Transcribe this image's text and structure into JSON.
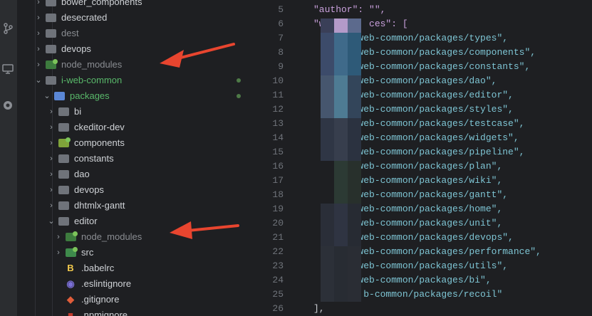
{
  "activity_bar": {
    "icons": [
      "branch-icon",
      "monitor-icon",
      "remote-icon"
    ]
  },
  "explorer": {
    "items": [
      {
        "label": "bower_components",
        "icon": "folder",
        "depth": 1,
        "expanded": false
      },
      {
        "label": "desecrated",
        "icon": "folder",
        "depth": 1,
        "expanded": false
      },
      {
        "label": "dest",
        "icon": "folder",
        "depth": 1,
        "expanded": false,
        "dim": true
      },
      {
        "label": "devops",
        "icon": "folder",
        "depth": 1,
        "expanded": false
      },
      {
        "label": "node_modules",
        "icon": "node-folder",
        "depth": 1,
        "expanded": false,
        "dim": true
      },
      {
        "label": "i-web-common",
        "icon": "folder",
        "depth": 1,
        "expanded": true,
        "green": true
      },
      {
        "label": "packages",
        "icon": "folder-open",
        "depth": 2,
        "expanded": true,
        "green": true
      },
      {
        "label": "bi",
        "icon": "folder",
        "depth": 3,
        "expanded": false
      },
      {
        "label": "ckeditor-dev",
        "icon": "folder",
        "depth": 3,
        "expanded": false
      },
      {
        "label": "components",
        "icon": "comp-folder",
        "depth": 3,
        "expanded": false
      },
      {
        "label": "constants",
        "icon": "folder",
        "depth": 3,
        "expanded": false
      },
      {
        "label": "dao",
        "icon": "folder",
        "depth": 3,
        "expanded": false
      },
      {
        "label": "devops",
        "icon": "folder",
        "depth": 3,
        "expanded": false
      },
      {
        "label": "dhtmlx-gantt",
        "icon": "folder",
        "depth": 3,
        "expanded": false
      },
      {
        "label": "editor",
        "icon": "folder",
        "depth": 3,
        "expanded": true
      },
      {
        "label": "node_modules",
        "icon": "node-folder",
        "depth": 4,
        "expanded": false,
        "dim": true
      },
      {
        "label": "src",
        "icon": "src-folder",
        "depth": 4,
        "expanded": false
      },
      {
        "label": ".babelrc",
        "icon": "babel-file",
        "depth": 4
      },
      {
        "label": ".eslintignore",
        "icon": "eslint-file",
        "depth": 4
      },
      {
        "label": ".gitignore",
        "icon": "git-file",
        "depth": 4
      },
      {
        "label": ".npmignore",
        "icon": "npm-file",
        "depth": 4
      }
    ]
  },
  "editor": {
    "lines": [
      {
        "n": "5",
        "text": "\"author\": \"\","
      },
      {
        "n": "6",
        "text": "\"w        ces\": ["
      },
      {
        "n": "7",
        "text": "      i-web-common/packages/types\","
      },
      {
        "n": "8",
        "text": "      i-web-common/packages/components\","
      },
      {
        "n": "9",
        "text": "      i-web-common/packages/constants\","
      },
      {
        "n": "10",
        "text": "      i-web-common/packages/dao\","
      },
      {
        "n": "11",
        "text": "      i-web-common/packages/editor\","
      },
      {
        "n": "12",
        "text": "       -web-common/packages/styles\","
      },
      {
        "n": "13",
        "text": "       -web-common/packages/testcase\","
      },
      {
        "n": "14",
        "text": "       -web-common/packages/widgets\","
      },
      {
        "n": "15",
        "text": "       -web-common/packages/pipeline\","
      },
      {
        "n": "16",
        "text": "      i-web-common/packages/plan\","
      },
      {
        "n": "17",
        "text": "       -web-common/packages/wiki\","
      },
      {
        "n": "18",
        "text": "      i-web-common/packages/gantt\","
      },
      {
        "n": "19",
        "text": "       -web-common/packages/home\","
      },
      {
        "n": "20",
        "text": "       -web-common/packages/unit\","
      },
      {
        "n": "21",
        "text": "        web-common/packages/devops\","
      },
      {
        "n": "22",
        "text": "        web-common/packages/performance\","
      },
      {
        "n": "23",
        "text": "       -web-common/packages/utils\","
      },
      {
        "n": "24",
        "text": "        web-common/packages/bi\","
      },
      {
        "n": "25",
        "text": "         b-common/packages/recoil\""
      },
      {
        "n": "26",
        "text": "],"
      }
    ]
  },
  "colors": {
    "background": "#1e1f22",
    "arrow": "#e8452f",
    "string": "#7ec5d4",
    "key": "#c9a0dc"
  }
}
